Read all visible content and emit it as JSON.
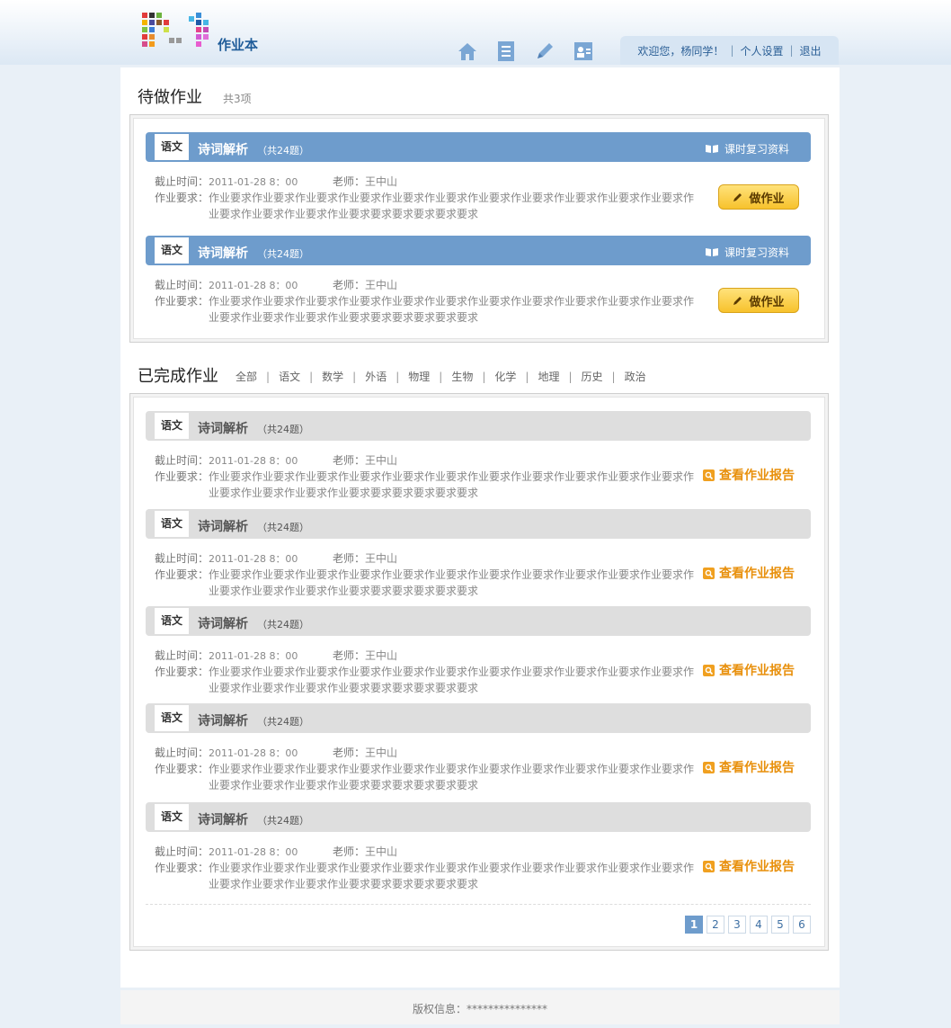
{
  "app": {
    "title": "作业本"
  },
  "colors": {
    "accent": "#6e9ccc",
    "button": "#f7c22c",
    "report": "#e8900c",
    "done_header": "#dedede"
  },
  "nav": {
    "icons": [
      "home-icon",
      "book-icon",
      "pencil-icon",
      "contacts-icon"
    ]
  },
  "userbar": {
    "welcome": "欢迎您，杨同学！",
    "settings": "个人设置",
    "logout": "退出",
    "separator": "|"
  },
  "pending": {
    "title": "待做作业",
    "count": "共3项",
    "items": [
      {
        "subject": "语文",
        "title": "诗词解析",
        "count": "（共24题）",
        "review": "课时复习资料",
        "deadline_label": "截止时间：",
        "deadline": "2011-01-28 8：00",
        "teacher_label": "老师：",
        "teacher": "王中山",
        "req_label": "作业要求：",
        "requirement": "作业要求作业要求作业要求作业要求作业要求作业要求作业要求作业要求作业要求作业要求作业要求作业要求作业要求作业要求作业要求要求要求要求要求要求",
        "action": "做作业"
      },
      {
        "subject": "语文",
        "title": "诗词解析",
        "count": "（共24题）",
        "review": "课时复习资料",
        "deadline_label": "截止时间：",
        "deadline": "2011-01-28 8：00",
        "teacher_label": "老师：",
        "teacher": "王中山",
        "req_label": "作业要求：",
        "requirement": "作业要求作业要求作业要求作业要求作业要求作业要求作业要求作业要求作业要求作业要求作业要求作业要求作业要求作业要求作业要求要求要求要求要求要求",
        "action": "做作业"
      }
    ]
  },
  "completed": {
    "title": "已完成作业",
    "filters": [
      "全部",
      "语文",
      "数学",
      "外语",
      "物理",
      "生物",
      "化学",
      "地理",
      "历史",
      "政治"
    ],
    "items": [
      {
        "subject": "语文",
        "title": "诗词解析",
        "count": "（共24题）",
        "deadline_label": "截止时间：",
        "deadline": "2011-01-28 8：00",
        "teacher_label": "老师：",
        "teacher": "王中山",
        "req_label": "作业要求：",
        "requirement": "作业要求作业要求作业要求作业要求作业要求作业要求作业要求作业要求作业要求作业要求作业要求作业要求作业要求作业要求作业要求要求要求要求要求要求",
        "action": "查看作业报告"
      },
      {
        "subject": "语文",
        "title": "诗词解析",
        "count": "（共24题）",
        "deadline_label": "截止时间：",
        "deadline": "2011-01-28 8：00",
        "teacher_label": "老师：",
        "teacher": "王中山",
        "req_label": "作业要求：",
        "requirement": "作业要求作业要求作业要求作业要求作业要求作业要求作业要求作业要求作业要求作业要求作业要求作业要求作业要求作业要求作业要求要求要求要求要求要求",
        "action": "查看作业报告"
      },
      {
        "subject": "语文",
        "title": "诗词解析",
        "count": "（共24题）",
        "deadline_label": "截止时间：",
        "deadline": "2011-01-28 8：00",
        "teacher_label": "老师：",
        "teacher": "王中山",
        "req_label": "作业要求：",
        "requirement": "作业要求作业要求作业要求作业要求作业要求作业要求作业要求作业要求作业要求作业要求作业要求作业要求作业要求作业要求作业要求要求要求要求要求要求",
        "action": "查看作业报告"
      },
      {
        "subject": "语文",
        "title": "诗词解析",
        "count": "（共24题）",
        "deadline_label": "截止时间：",
        "deadline": "2011-01-28 8：00",
        "teacher_label": "老师：",
        "teacher": "王中山",
        "req_label": "作业要求：",
        "requirement": "作业要求作业要求作业要求作业要求作业要求作业要求作业要求作业要求作业要求作业要求作业要求作业要求作业要求作业要求作业要求要求要求要求要求要求",
        "action": "查看作业报告"
      },
      {
        "subject": "语文",
        "title": "诗词解析",
        "count": "（共24题）",
        "deadline_label": "截止时间：",
        "deadline": "2011-01-28 8：00",
        "teacher_label": "老师：",
        "teacher": "王中山",
        "req_label": "作业要求：",
        "requirement": "作业要求作业要求作业要求作业要求作业要求作业要求作业要求作业要求作业要求作业要求作业要求作业要求作业要求作业要求作业要求要求要求要求要求要求",
        "action": "查看作业报告"
      }
    ],
    "pages": [
      "1",
      "2",
      "3",
      "4",
      "5",
      "6"
    ],
    "current_page": "1"
  },
  "footer": {
    "copyright": "版权信息：***************"
  }
}
